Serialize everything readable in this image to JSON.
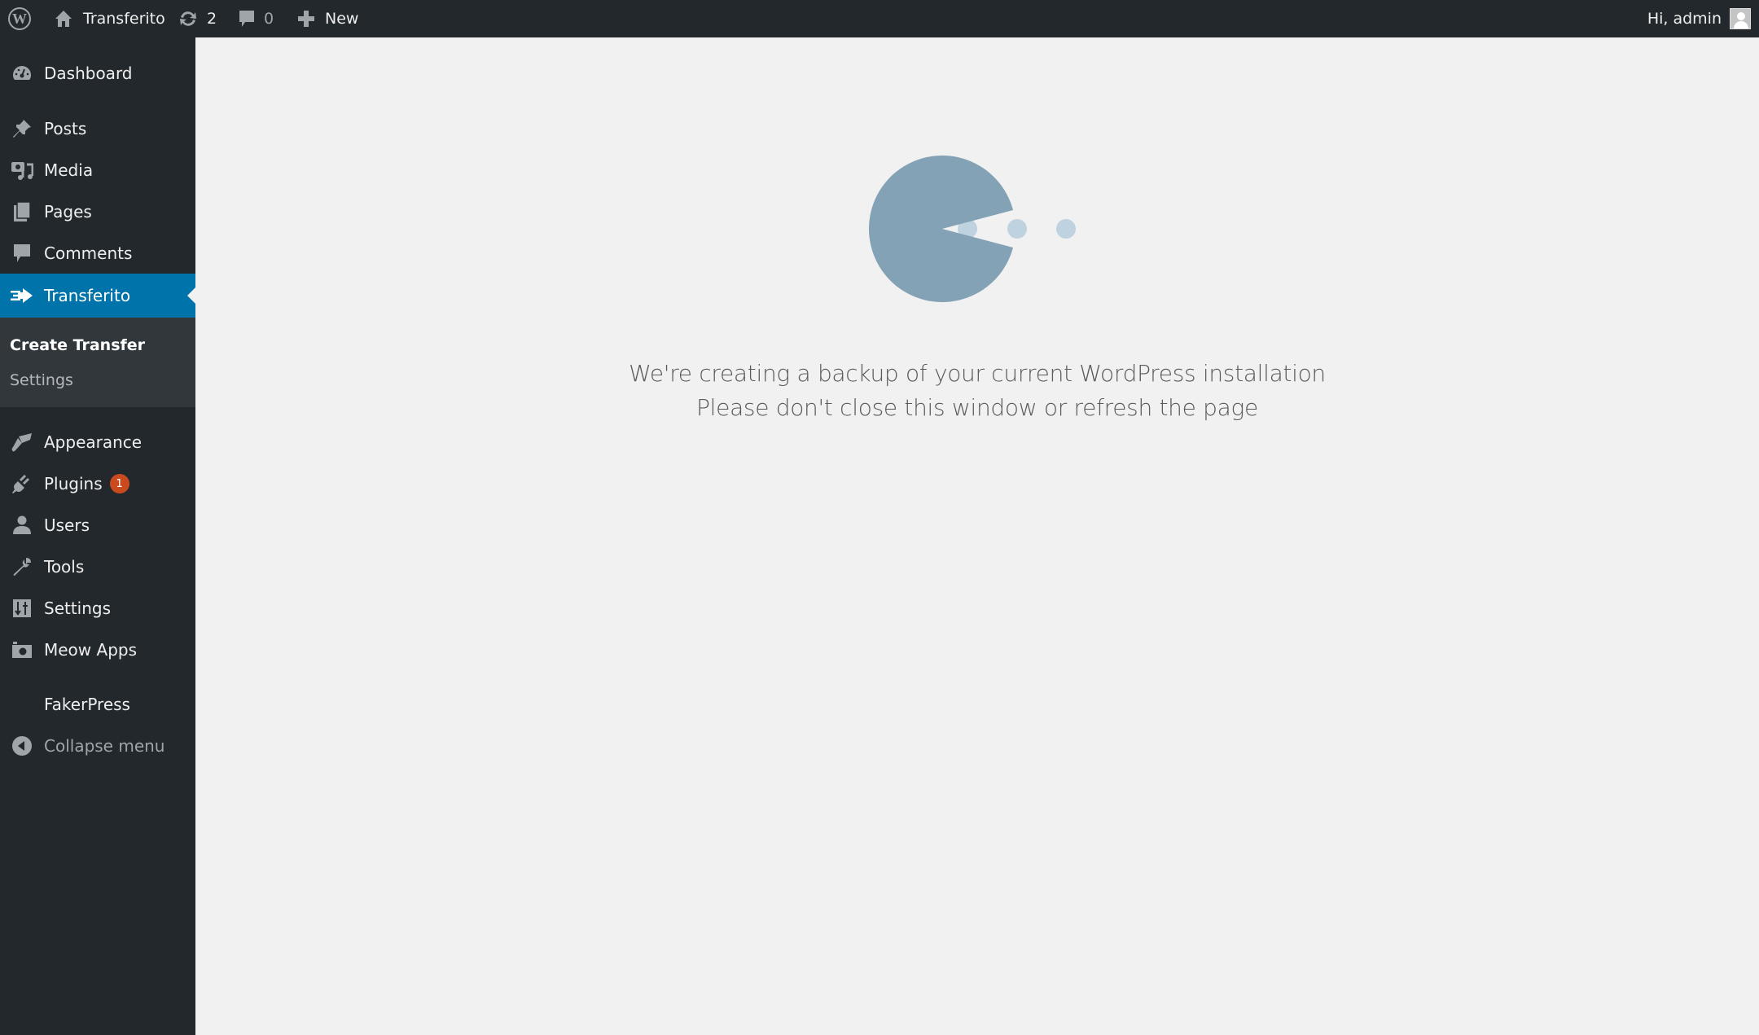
{
  "admin_bar": {
    "wp_logo_icon": "wordpress-logo-icon",
    "site_name": "Transferito",
    "updates_count": "2",
    "comments_count": "0",
    "new_label": "New",
    "greeting": "Hi, admin"
  },
  "sidebar": {
    "items": [
      {
        "label": "Dashboard",
        "icon": "dashboard-icon"
      },
      {
        "label": "Posts",
        "icon": "pin-icon"
      },
      {
        "label": "Media",
        "icon": "media-icon"
      },
      {
        "label": "Pages",
        "icon": "pages-icon"
      },
      {
        "label": "Comments",
        "icon": "comment-icon"
      },
      {
        "label": "Transferito",
        "icon": "transfer-arrow-icon",
        "active": true
      },
      {
        "label": "Appearance",
        "icon": "brush-icon"
      },
      {
        "label": "Plugins",
        "icon": "plug-icon",
        "badge": "1"
      },
      {
        "label": "Users",
        "icon": "user-icon"
      },
      {
        "label": "Tools",
        "icon": "wrench-icon"
      },
      {
        "label": "Settings",
        "icon": "sliders-icon"
      },
      {
        "label": "Meow Apps",
        "icon": "camera-icon"
      },
      {
        "label": "FakerPress",
        "icon": ""
      },
      {
        "label": "Collapse menu",
        "icon": "collapse-arrow-icon"
      }
    ],
    "submenu": [
      {
        "label": "Create Transfer",
        "current": true
      },
      {
        "label": "Settings",
        "current": false
      }
    ]
  },
  "main": {
    "loader_icon": "pacman-loader-icon",
    "message_line1": "We're creating a backup of your current WordPress installation",
    "message_line2": "Please don't close this window or refresh the page"
  },
  "colors": {
    "admin_bar_bg": "#23282d",
    "active_menu_bg": "#0073aa",
    "badge_bg": "#ca4a1f",
    "loader_body": "#84a2b6",
    "loader_dots": "#bfd2df",
    "content_bg": "#f1f1f1"
  }
}
